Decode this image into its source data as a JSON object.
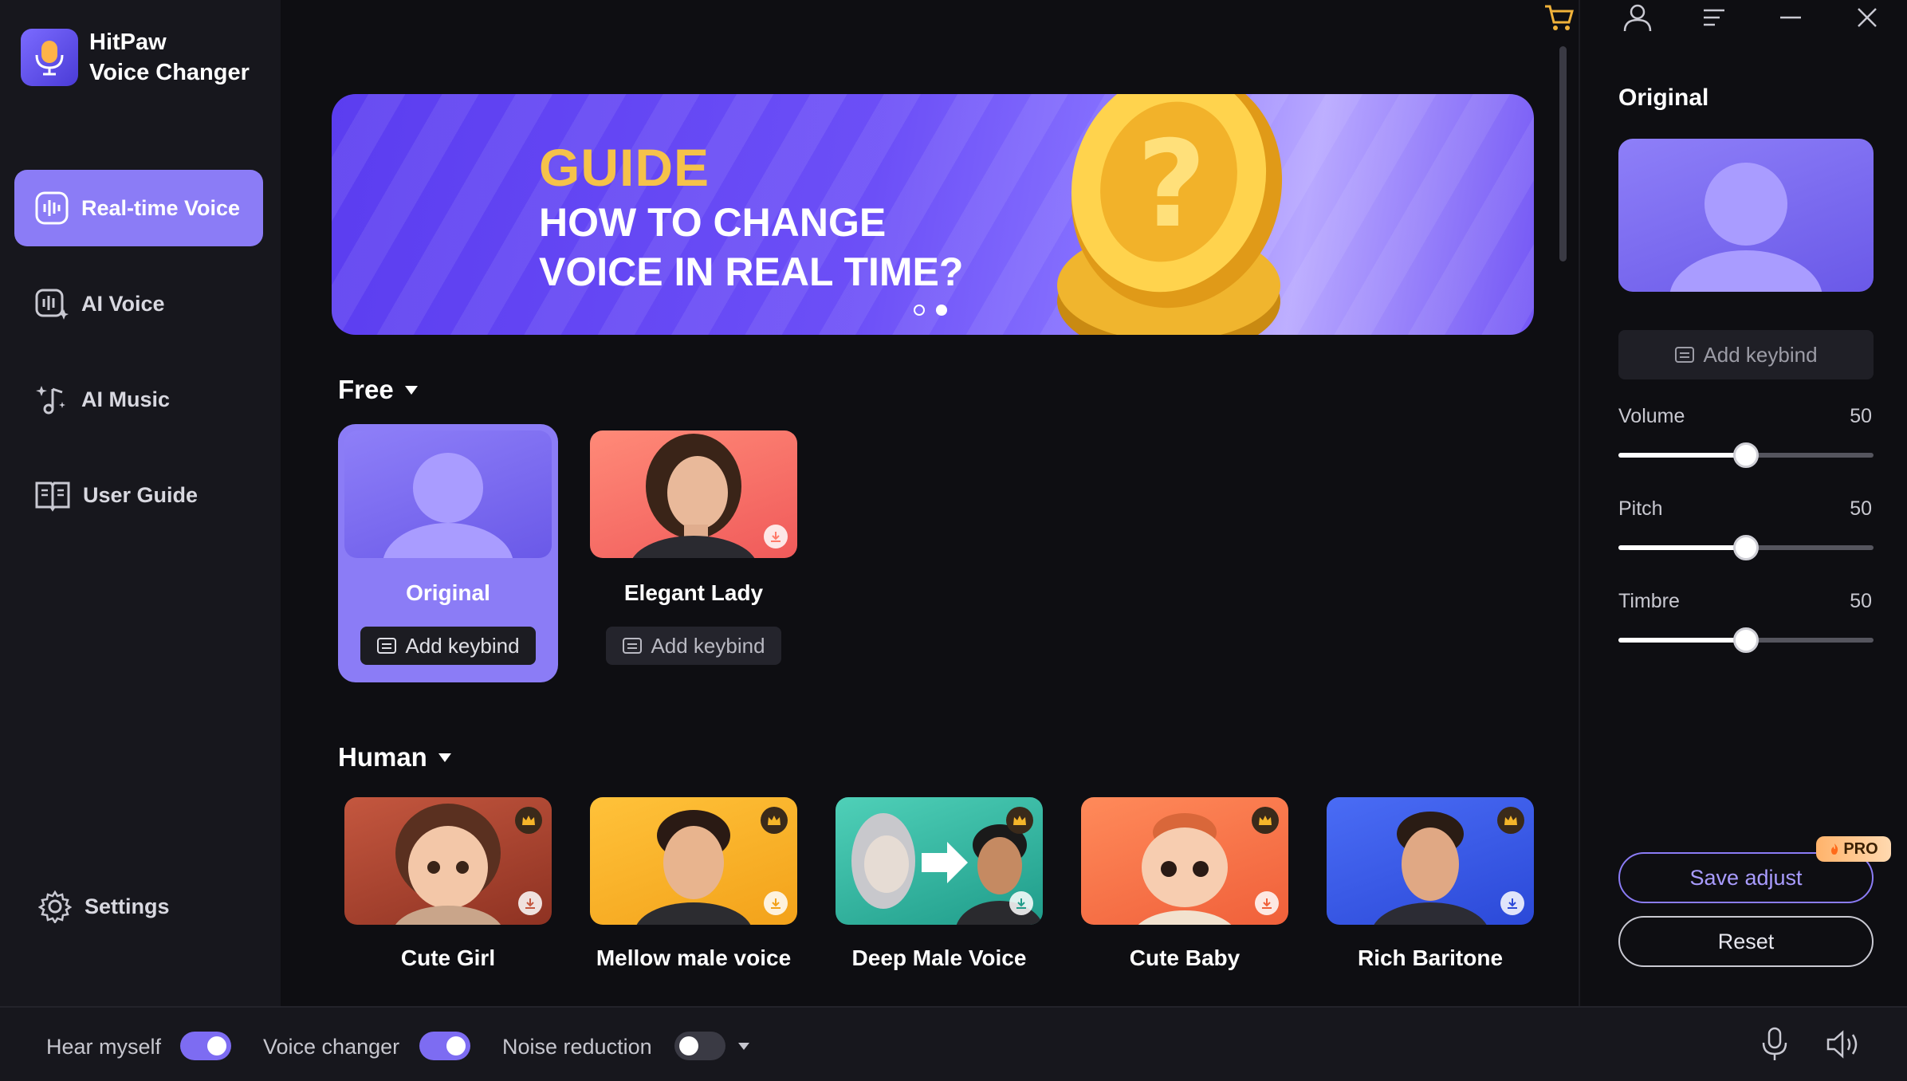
{
  "app": {
    "name_line1": "HitPaw",
    "name_line2": "Voice Changer"
  },
  "sidebar": {
    "items": [
      {
        "label": "Real-time Voice",
        "icon": "waveform-icon",
        "active": true
      },
      {
        "label": "AI Voice",
        "icon": "ai-voice-icon",
        "active": false
      },
      {
        "label": "AI Music",
        "icon": "music-sparkle-icon",
        "active": false
      },
      {
        "label": "User Guide",
        "icon": "book-icon",
        "active": false
      }
    ],
    "settings_label": "Settings"
  },
  "topbar": {
    "icons": [
      "cart-icon",
      "user-icon",
      "menu-icon",
      "minimize-icon",
      "close-icon"
    ]
  },
  "banner": {
    "guide": "GUIDE",
    "line1": "HOW TO CHANGE",
    "line2": "VOICE IN REAL TIME?",
    "slide_count": 2,
    "active_slide": 2
  },
  "sections": {
    "free": {
      "title": "Free",
      "cards": [
        {
          "name": "Original",
          "keybind": "Add keybind",
          "selected": true
        },
        {
          "name": "Elegant Lady",
          "keybind": "Add keybind",
          "selected": false
        }
      ]
    },
    "human": {
      "title": "Human",
      "cards": [
        {
          "name": "Cute Girl",
          "premium": true
        },
        {
          "name": "Mellow male voice",
          "premium": true
        },
        {
          "name": "Deep Male Voice",
          "premium": true
        },
        {
          "name": "Cute Baby",
          "premium": true
        },
        {
          "name": "Rich Baritone",
          "premium": true
        }
      ]
    }
  },
  "panel": {
    "title": "Original",
    "keybind": "Add keybind",
    "sliders": [
      {
        "label": "Volume",
        "value": 50,
        "display": "50",
        "max": 100
      },
      {
        "label": "Pitch",
        "value": 50,
        "display": "50",
        "max": 100
      },
      {
        "label": "Timbre",
        "value": 50,
        "display": "50",
        "max": 100
      }
    ],
    "save_label": "Save adjust",
    "pro_badge": "PRO",
    "reset_label": "Reset"
  },
  "bottombar": {
    "hear_myself": {
      "label": "Hear myself",
      "on": true
    },
    "voice_changer": {
      "label": "Voice changer",
      "on": true
    },
    "noise_reduction": {
      "label": "Noise reduction",
      "on": false
    },
    "icons": [
      "microphone-icon",
      "speaker-icon"
    ]
  },
  "colors": {
    "accent": "#8b7cf6",
    "background": "#0e0e12",
    "sidebar": "#17171d",
    "banner_gold": "#f5c24a"
  }
}
